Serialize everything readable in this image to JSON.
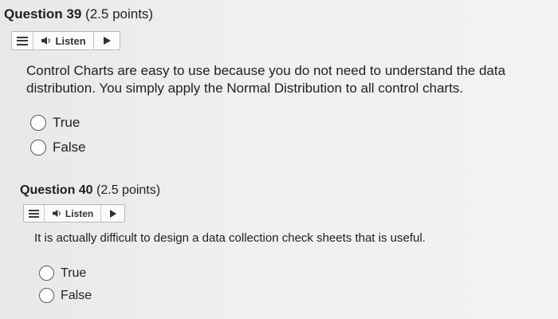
{
  "questions": [
    {
      "number": "Question 39",
      "points": "(2.5 points)",
      "listen": {
        "label": "Listen"
      },
      "prompt": "Control Charts are easy to use because you do not need to understand the data distribution. You simply apply the Normal Distribution to all control charts.",
      "options": [
        "True",
        "False"
      ]
    },
    {
      "number": "Question 40",
      "points": "(2.5 points)",
      "listen": {
        "label": "Listen"
      },
      "prompt": "It is actually difficult to design a data collection check sheets that is useful.",
      "options": [
        "True",
        "False"
      ]
    }
  ],
  "icons": {
    "menu": "hamburger-menu-icon",
    "speaker": "speaker-icon",
    "play": "play-icon"
  }
}
